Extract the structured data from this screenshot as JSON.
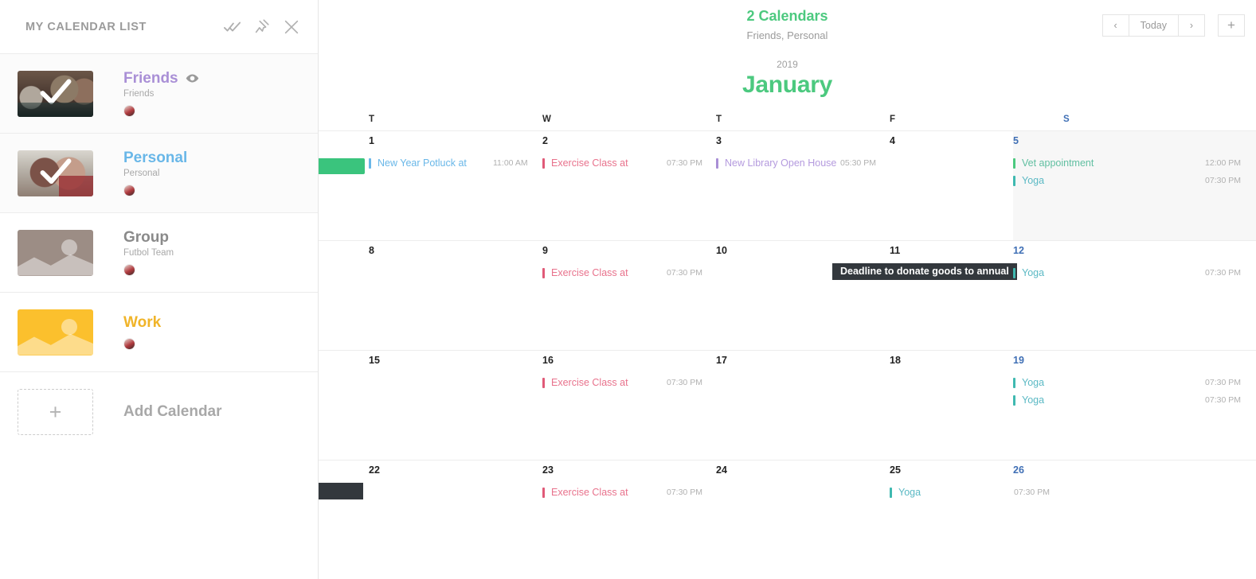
{
  "sidebar": {
    "title": "MY CALENDAR LIST",
    "actions": [
      {
        "name": "check-all-icon",
        "label": "check-all"
      },
      {
        "name": "pin-icon",
        "label": "pin"
      },
      {
        "name": "close-icon",
        "label": "close"
      }
    ],
    "calendars": [
      {
        "name": "Friends",
        "subtitle": "Friends",
        "color": "#a98fd6",
        "checked": true,
        "has_eye": true,
        "thumb": "photo-friends"
      },
      {
        "name": "Personal",
        "subtitle": "Personal",
        "color": "#69b7e8",
        "checked": true,
        "has_eye": false,
        "thumb": "photo-personal"
      },
      {
        "name": "Group",
        "subtitle": "Futbol Team",
        "color": "#8a8a8a",
        "checked": false,
        "has_eye": false,
        "thumb": "placeholder-brown",
        "placeholder_color": "#9c8d85"
      },
      {
        "name": "Work",
        "subtitle": "",
        "color": "#f0b429",
        "checked": false,
        "has_eye": false,
        "thumb": "placeholder-yellow",
        "placeholder_color": "#fbc02d"
      }
    ],
    "add_calendar": {
      "label": "Add Calendar",
      "icon": "plus-icon"
    }
  },
  "header": {
    "calendar_count": "2 Calendars",
    "calendar_names": "Friends, Personal",
    "year": "2019",
    "month": "January",
    "accent": "#4cc97f",
    "nav": {
      "prev": "‹",
      "today": "Today",
      "next": "›",
      "add": "+"
    }
  },
  "grid": {
    "day_headers": [
      {
        "label": "T",
        "weekend": false
      },
      {
        "label": "W",
        "weekend": false
      },
      {
        "label": "T",
        "weekend": false
      },
      {
        "label": "F",
        "weekend": false
      },
      {
        "label": "S",
        "weekend": true
      }
    ],
    "weeks": [
      {
        "days": [
          {
            "num": "1",
            "weekend": false,
            "events": [
              {
                "title": "New Year Potluck at",
                "time": "11:00 AM",
                "color": "#69b7e8",
                "text_color": "#69b7e8"
              }
            ]
          },
          {
            "num": "2",
            "weekend": false,
            "events": [
              {
                "title": "Exercise Class at",
                "time": "07:30 PM",
                "color": "#e05a78",
                "text_color": "#e8728c"
              }
            ]
          },
          {
            "num": "3",
            "weekend": false,
            "events": [
              {
                "title": "New Library Open House",
                "time": "05:30 PM",
                "color": "#a98fd6",
                "text_color": "#b49ade"
              }
            ]
          },
          {
            "num": "4",
            "weekend": false,
            "events": []
          },
          {
            "num": "5",
            "weekend": true,
            "shaded": true,
            "events": [
              {
                "title": "Vet appointment",
                "time": "12:00 PM",
                "color": "#4cc97f",
                "text_color": "#61bfa1"
              },
              {
                "title": "Yoga",
                "time": "07:30 PM",
                "color": "#3fb9b0",
                "text_color": "#5bb9c4"
              }
            ]
          }
        ]
      },
      {
        "days": [
          {
            "num": "8",
            "weekend": false,
            "events": []
          },
          {
            "num": "9",
            "weekend": false,
            "events": [
              {
                "title": "Exercise Class at",
                "time": "07:30 PM",
                "color": "#e05a78",
                "text_color": "#e8728c"
              }
            ]
          },
          {
            "num": "10",
            "weekend": false,
            "events": []
          },
          {
            "num": "11",
            "weekend": false,
            "tooltip": "Deadline to donate goods to annual",
            "events": []
          },
          {
            "num": "12",
            "weekend": true,
            "shaded": false,
            "events": [
              {
                "title": "Yoga",
                "time": "07:30 PM",
                "color": "#3fb9b0",
                "text_color": "#5bb9c4"
              }
            ]
          }
        ]
      },
      {
        "days": [
          {
            "num": "15",
            "weekend": false,
            "events": []
          },
          {
            "num": "16",
            "weekend": false,
            "events": [
              {
                "title": "Exercise Class at",
                "time": "07:30 PM",
                "color": "#e05a78",
                "text_color": "#e8728c"
              }
            ]
          },
          {
            "num": "17",
            "weekend": false,
            "events": []
          },
          {
            "num": "18",
            "weekend": false,
            "events": []
          },
          {
            "num": "19",
            "weekend": true,
            "shaded": false,
            "events": [
              {
                "title": "Yoga",
                "time": "07:30 PM",
                "color": "#3fb9b0",
                "text_color": "#5bb9c4"
              },
              {
                "title": "Yoga",
                "time": "07:30 PM",
                "color": "#3fb9b0",
                "text_color": "#5bb9c4"
              }
            ]
          }
        ]
      },
      {
        "days": [
          {
            "num": "22",
            "weekend": false,
            "events": []
          },
          {
            "num": "23",
            "weekend": false,
            "events": [
              {
                "title": "Exercise Class at",
                "time": "07:30 PM",
                "color": "#e05a78",
                "text_color": "#e8728c"
              }
            ]
          },
          {
            "num": "24",
            "weekend": false,
            "events": []
          },
          {
            "num": "25",
            "weekend": false,
            "events": [
              {
                "title": "Yoga",
                "time": "07:30 PM",
                "color": "#3fb9b0",
                "text_color": "#5bb9c4"
              }
            ]
          },
          {
            "num": "26",
            "weekend": true,
            "shaded": false,
            "events": []
          }
        ]
      }
    ]
  }
}
